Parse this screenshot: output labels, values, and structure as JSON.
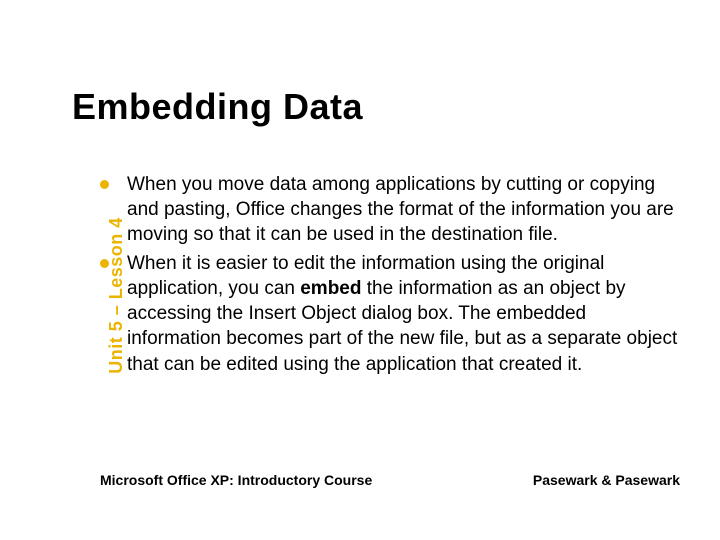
{
  "title": "Embedding Data",
  "sidebar_label": "Unit 5 – Lesson 4",
  "bullets": [
    {
      "text": "When you move data among applications by cutting or copying and pasting, Office changes the format of the information you are moving so that it can be used in the destination file."
    },
    {
      "text_pre": "When it is easier to edit the information using the original application, you can ",
      "text_bold": "embed",
      "text_post": " the information as an object by accessing the Insert Object dialog box. The embedded information becomes part of the new file, but as a separate object that can be edited using the application that created it."
    }
  ],
  "footer_left": "Microsoft Office XP:  Introductory Course",
  "footer_right": "Pasewark & Pasewark",
  "colors": {
    "accent": "#EBB400"
  }
}
